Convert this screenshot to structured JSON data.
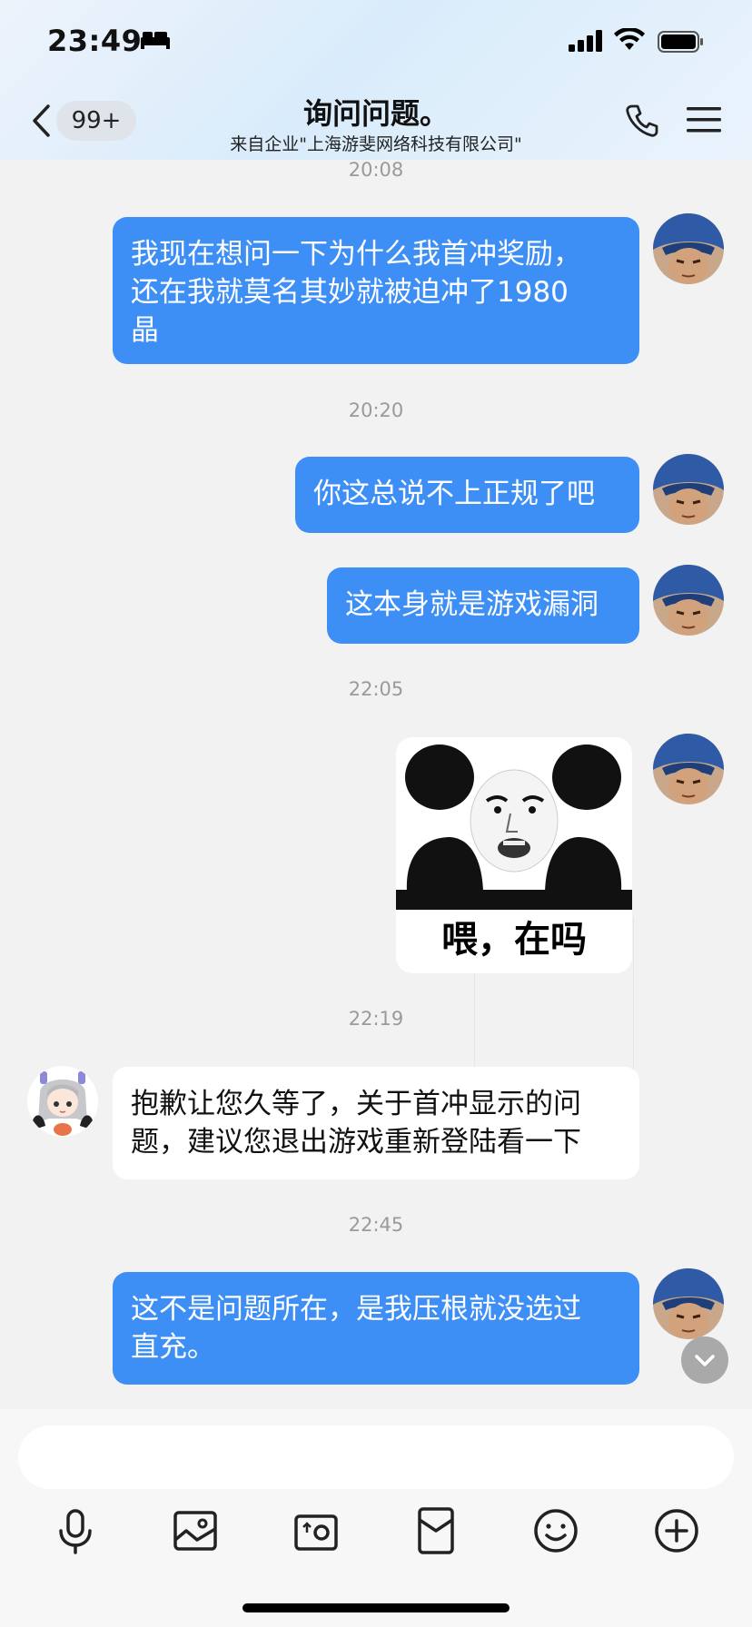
{
  "status_bar": {
    "time": "23:49"
  },
  "header": {
    "unread_count": "99+",
    "title": "询问问题。",
    "subtitle": "来自企业\"上海游斐网络科技有限公司\""
  },
  "messages": [
    {
      "time": "20:08"
    },
    {
      "sender": "me",
      "text": "我现在想问一下为什么我首冲奖励，\n还在我就莫名其妙就被迫冲了1980\n晶"
    },
    {
      "time": "20:20"
    },
    {
      "sender": "me",
      "text": "你这总说不上正规了吧"
    },
    {
      "sender": "me",
      "text": "这本身就是游戏漏洞"
    },
    {
      "time": "22:05"
    },
    {
      "sender": "me",
      "sticker_caption": "喂，在吗"
    },
    {
      "time": "22:19"
    },
    {
      "sender": "them",
      "text": "抱歉让您久等了，关于首冲显示的问\n题，建议您退出游戏重新登陆看一下"
    },
    {
      "time": "22:45"
    },
    {
      "sender": "me",
      "text": "这不是问题所在，是我压根就没选过\n直充。"
    }
  ],
  "input": {
    "value": "",
    "placeholder": ""
  },
  "toolbar": [
    "microphone-icon",
    "photo-icon",
    "camera-icon",
    "red-packet-icon",
    "emoji-icon",
    "plus-icon"
  ],
  "colors": {
    "my_bubble": "#3d8ff6",
    "their_bubble": "#ffffff",
    "background": "#f2f2f2"
  }
}
